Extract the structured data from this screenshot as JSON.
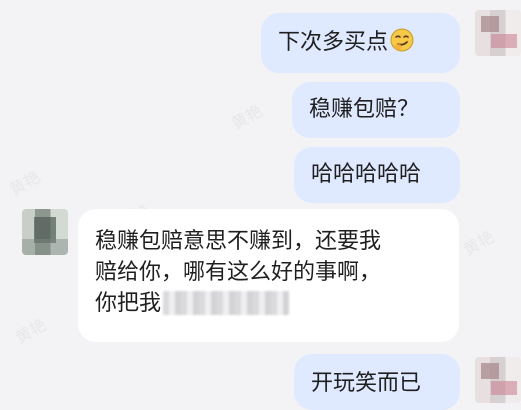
{
  "chat": {
    "messages": [
      {
        "sender": "me",
        "text": "下次多买点",
        "emoji": "smirk-face-icon"
      },
      {
        "sender": "me",
        "text": "稳赚包赔？"
      },
      {
        "sender": "me",
        "text": "哈哈哈哈哈"
      },
      {
        "sender": "other",
        "lines": [
          "稳赚包赔意思不赚到，还要我",
          "赔给你，哪有这么好的事啊，",
          "你把我"
        ],
        "redacted": true
      },
      {
        "sender": "me",
        "text": "开玩笑而已"
      }
    ],
    "watermark": "黄艳"
  },
  "colors": {
    "background": "#f3f3f5",
    "my_bubble": "#dfe9ff",
    "other_bubble": "#ffffff",
    "text": "#1f1f1f"
  }
}
